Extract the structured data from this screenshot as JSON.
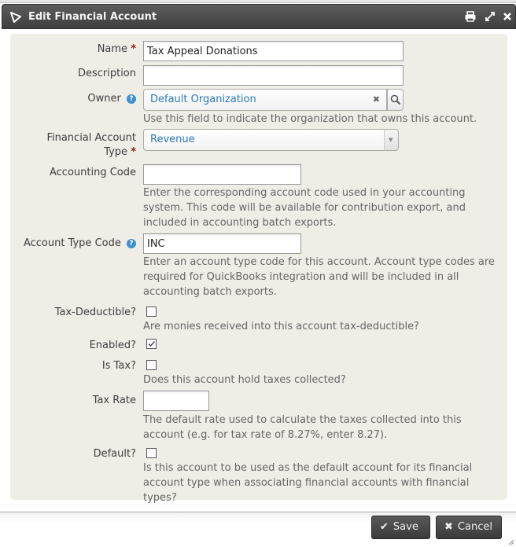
{
  "dialog": {
    "title": "Edit Financial Account",
    "icons": [
      "print-icon",
      "maximize-icon",
      "close-icon"
    ]
  },
  "form": {
    "name": {
      "label": "Name",
      "required_mark": "*",
      "value": "Tax Appeal Donations"
    },
    "description": {
      "label": "Description",
      "value": ""
    },
    "owner": {
      "label": "Owner",
      "help_icon": "?",
      "value": "Default Organization",
      "clear_icon": "✖",
      "help_text": "Use this field to indicate the organization that owns this account."
    },
    "financial_account_type": {
      "label_line1": "Financial Account",
      "label_line2": "Type",
      "required_mark": "*",
      "value": "Revenue"
    },
    "accounting_code": {
      "label": "Accounting Code",
      "value": "",
      "help_text": "Enter the corresponding account code used in your accounting system. This code will be available for contribution export, and included in accounting batch exports."
    },
    "account_type_code": {
      "label": "Account Type Code",
      "help_icon": "?",
      "value": "INC",
      "help_text": "Enter an account type code for this account. Account type codes are required for QuickBooks integration and will be included in all accounting batch exports."
    },
    "tax_deductible": {
      "label": "Tax-Deductible?",
      "checked": false,
      "help_text": "Are monies received into this account tax-deductible?"
    },
    "enabled": {
      "label": "Enabled?",
      "checked": true
    },
    "is_tax": {
      "label": "Is Tax?",
      "checked": false,
      "help_text": "Does this account hold taxes collected?"
    },
    "tax_rate": {
      "label": "Tax Rate",
      "value": "",
      "help_text": "The default rate used to calculate the taxes collected into this account (e.g. for tax rate of 8.27%, enter 8.27)."
    },
    "default": {
      "label": "Default?",
      "checked": false,
      "help_text": "Is this account to be used as the default account for its financial account type when associating financial accounts with financial types?"
    }
  },
  "buttons": {
    "save": {
      "icon": "✔",
      "label": "Save"
    },
    "cancel": {
      "icon": "✖",
      "label": "Cancel"
    }
  }
}
